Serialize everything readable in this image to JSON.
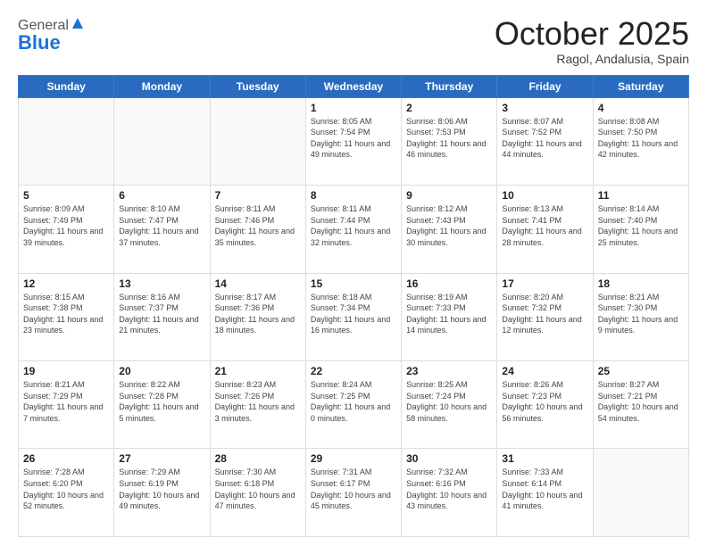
{
  "logo": {
    "general": "General",
    "blue": "Blue"
  },
  "header": {
    "month": "October 2025",
    "location": "Ragol, Andalusia, Spain"
  },
  "weekdays": [
    "Sunday",
    "Monday",
    "Tuesday",
    "Wednesday",
    "Thursday",
    "Friday",
    "Saturday"
  ],
  "weeks": [
    [
      {
        "day": "",
        "info": ""
      },
      {
        "day": "",
        "info": ""
      },
      {
        "day": "",
        "info": ""
      },
      {
        "day": "1",
        "info": "Sunrise: 8:05 AM\nSunset: 7:54 PM\nDaylight: 11 hours and 49 minutes."
      },
      {
        "day": "2",
        "info": "Sunrise: 8:06 AM\nSunset: 7:53 PM\nDaylight: 11 hours and 46 minutes."
      },
      {
        "day": "3",
        "info": "Sunrise: 8:07 AM\nSunset: 7:52 PM\nDaylight: 11 hours and 44 minutes."
      },
      {
        "day": "4",
        "info": "Sunrise: 8:08 AM\nSunset: 7:50 PM\nDaylight: 11 hours and 42 minutes."
      }
    ],
    [
      {
        "day": "5",
        "info": "Sunrise: 8:09 AM\nSunset: 7:49 PM\nDaylight: 11 hours and 39 minutes."
      },
      {
        "day": "6",
        "info": "Sunrise: 8:10 AM\nSunset: 7:47 PM\nDaylight: 11 hours and 37 minutes."
      },
      {
        "day": "7",
        "info": "Sunrise: 8:11 AM\nSunset: 7:46 PM\nDaylight: 11 hours and 35 minutes."
      },
      {
        "day": "8",
        "info": "Sunrise: 8:11 AM\nSunset: 7:44 PM\nDaylight: 11 hours and 32 minutes."
      },
      {
        "day": "9",
        "info": "Sunrise: 8:12 AM\nSunset: 7:43 PM\nDaylight: 11 hours and 30 minutes."
      },
      {
        "day": "10",
        "info": "Sunrise: 8:13 AM\nSunset: 7:41 PM\nDaylight: 11 hours and 28 minutes."
      },
      {
        "day": "11",
        "info": "Sunrise: 8:14 AM\nSunset: 7:40 PM\nDaylight: 11 hours and 25 minutes."
      }
    ],
    [
      {
        "day": "12",
        "info": "Sunrise: 8:15 AM\nSunset: 7:38 PM\nDaylight: 11 hours and 23 minutes."
      },
      {
        "day": "13",
        "info": "Sunrise: 8:16 AM\nSunset: 7:37 PM\nDaylight: 11 hours and 21 minutes."
      },
      {
        "day": "14",
        "info": "Sunrise: 8:17 AM\nSunset: 7:36 PM\nDaylight: 11 hours and 18 minutes."
      },
      {
        "day": "15",
        "info": "Sunrise: 8:18 AM\nSunset: 7:34 PM\nDaylight: 11 hours and 16 minutes."
      },
      {
        "day": "16",
        "info": "Sunrise: 8:19 AM\nSunset: 7:33 PM\nDaylight: 11 hours and 14 minutes."
      },
      {
        "day": "17",
        "info": "Sunrise: 8:20 AM\nSunset: 7:32 PM\nDaylight: 11 hours and 12 minutes."
      },
      {
        "day": "18",
        "info": "Sunrise: 8:21 AM\nSunset: 7:30 PM\nDaylight: 11 hours and 9 minutes."
      }
    ],
    [
      {
        "day": "19",
        "info": "Sunrise: 8:21 AM\nSunset: 7:29 PM\nDaylight: 11 hours and 7 minutes."
      },
      {
        "day": "20",
        "info": "Sunrise: 8:22 AM\nSunset: 7:28 PM\nDaylight: 11 hours and 5 minutes."
      },
      {
        "day": "21",
        "info": "Sunrise: 8:23 AM\nSunset: 7:26 PM\nDaylight: 11 hours and 3 minutes."
      },
      {
        "day": "22",
        "info": "Sunrise: 8:24 AM\nSunset: 7:25 PM\nDaylight: 11 hours and 0 minutes."
      },
      {
        "day": "23",
        "info": "Sunrise: 8:25 AM\nSunset: 7:24 PM\nDaylight: 10 hours and 58 minutes."
      },
      {
        "day": "24",
        "info": "Sunrise: 8:26 AM\nSunset: 7:23 PM\nDaylight: 10 hours and 56 minutes."
      },
      {
        "day": "25",
        "info": "Sunrise: 8:27 AM\nSunset: 7:21 PM\nDaylight: 10 hours and 54 minutes."
      }
    ],
    [
      {
        "day": "26",
        "info": "Sunrise: 7:28 AM\nSunset: 6:20 PM\nDaylight: 10 hours and 52 minutes."
      },
      {
        "day": "27",
        "info": "Sunrise: 7:29 AM\nSunset: 6:19 PM\nDaylight: 10 hours and 49 minutes."
      },
      {
        "day": "28",
        "info": "Sunrise: 7:30 AM\nSunset: 6:18 PM\nDaylight: 10 hours and 47 minutes."
      },
      {
        "day": "29",
        "info": "Sunrise: 7:31 AM\nSunset: 6:17 PM\nDaylight: 10 hours and 45 minutes."
      },
      {
        "day": "30",
        "info": "Sunrise: 7:32 AM\nSunset: 6:16 PM\nDaylight: 10 hours and 43 minutes."
      },
      {
        "day": "31",
        "info": "Sunrise: 7:33 AM\nSunset: 6:14 PM\nDaylight: 10 hours and 41 minutes."
      },
      {
        "day": "",
        "info": ""
      }
    ]
  ]
}
